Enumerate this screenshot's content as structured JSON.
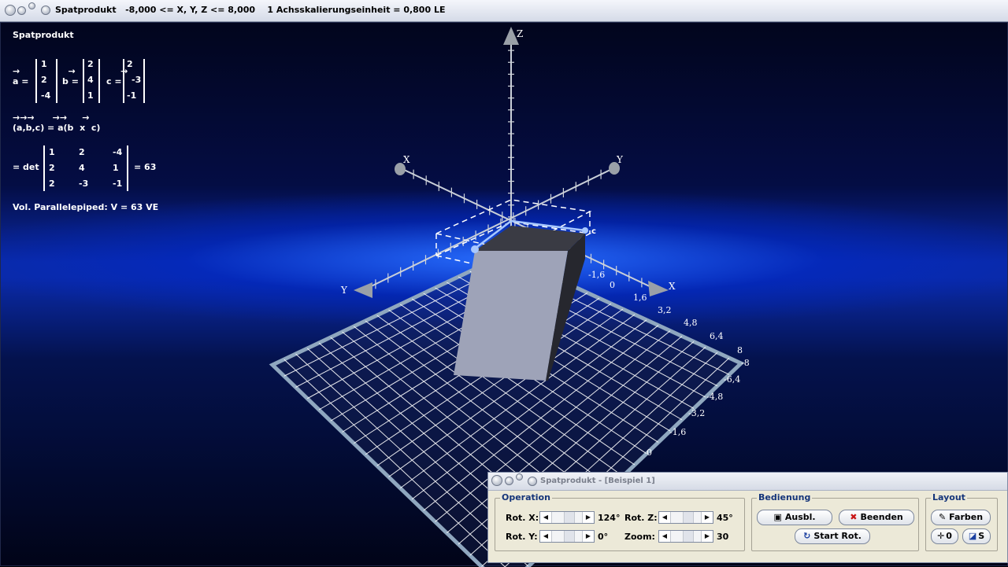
{
  "window": {
    "title": "Spatprodukt   -8,000 <= X, Y, Z <= 8,000    1 Achsskalierungseinheit = 0,800 LE"
  },
  "info": {
    "heading": "Spatprodukt",
    "arrows_abc": "→                →               →",
    "a_label": "a =",
    "b_label": "b =",
    "c_label": "c =",
    "vec_a": [
      "1",
      "2",
      "-4"
    ],
    "vec_b": [
      "2",
      "4",
      "1"
    ],
    "vec_c": [
      "2",
      "-3",
      "-1"
    ],
    "formula_arrows": "→→→      →→     →",
    "formula": "(a,b,c) = a(b  x  c)",
    "det_label": "= det",
    "det_rows": [
      [
        "1",
        "2",
        "-4"
      ],
      [
        "2",
        "4",
        "1"
      ],
      [
        "2",
        "-3",
        "-1"
      ]
    ],
    "det_result": "= 63",
    "volume": "Vol. Parallelepiped: V = 63 VE"
  },
  "scene": {
    "axis_labels": {
      "z": "Z",
      "x_back": "X",
      "y_back": "Y",
      "y_front": "Y",
      "x_front": "X",
      "c_vector": "c"
    },
    "x_ticks": [
      "-1,6",
      "0",
      "1,6",
      "3,2",
      "4,8",
      "6,4",
      "8"
    ],
    "y_ticks": [
      "-8",
      "-6,4",
      "-4,8",
      "-3,2",
      "-1,6",
      "0"
    ]
  },
  "dialog": {
    "title": "Spatprodukt - [Beispiel 1]",
    "operation": {
      "legend": "Operation",
      "rot_x_label": "Rot. X:",
      "rot_x_value": "124°",
      "rot_y_label": "Rot. Y:",
      "rot_y_value": "0°",
      "rot_z_label": "Rot. Z:",
      "rot_z_value": "45°",
      "zoom_label": "Zoom:",
      "zoom_value": "30"
    },
    "bedienung": {
      "legend": "Bedienung",
      "ausbl": "Ausbl.",
      "beenden": "Beenden",
      "start_rot": "Start Rot."
    },
    "layout": {
      "legend": "Layout",
      "farben": "Farben",
      "zero": "0",
      "s": "S"
    }
  },
  "colors": {
    "background_blue": "#0a2aa8",
    "box_face": "#9ea3b8",
    "box_dark": "#2a2b33",
    "grid_line": "#ffffff",
    "dialog_bg": "#ece9d8",
    "legend_text": "#15357a"
  }
}
